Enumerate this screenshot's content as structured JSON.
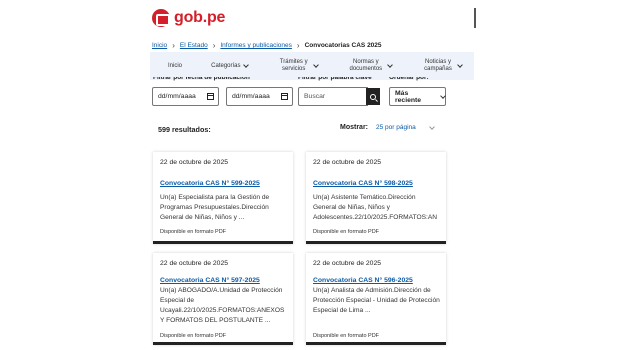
{
  "brand": {
    "name": "gob.pe"
  },
  "breadcrumb": {
    "items": [
      "Inicio",
      "El Estado",
      "Informes y publicaciones"
    ],
    "current": "Convocatorias CAS 2025"
  },
  "nav": {
    "items": [
      {
        "label": "Inicio",
        "dropdown": false
      },
      {
        "label": "Categorías",
        "dropdown": true
      },
      {
        "label": "Trámites y servicios",
        "dropdown": true
      },
      {
        "label": "Normas y documentos",
        "dropdown": true
      },
      {
        "label": "Noticias y campañas",
        "dropdown": true
      }
    ]
  },
  "filters": {
    "date_label": "Filtrar por fecha de publicación",
    "keyword_label": "Filtrar por palabra clave",
    "sort_label": "Ordenar por:",
    "date_from": "dd/mm/aaaa",
    "date_to": "dd/mm/aaaa",
    "search_placeholder": "Buscar",
    "sort_value": "Más reciente"
  },
  "results": {
    "count_text": "599 resultados:",
    "show_label": "Mostrar:",
    "per_page": "25 por página"
  },
  "cards": [
    {
      "date": "22 de octubre de 2025",
      "title": "Convocatoria CAS N° 599-2025",
      "description": "Un(a) Especialista para la Gestión de Programas Presupuestales.Dirección General de Niñas, Niños y ...",
      "format": "Disponible en formato PDF"
    },
    {
      "date": "22 de octubre de 2025",
      "title": "Convocatoria CAS N° 598-2025",
      "description": "Un(a) Asistente Temático.Dirección General de Niñas, Niños y Adolescentes.22/10/2025.FORMATOS:ANEXOS Y FORMATOS DEL ...",
      "format": "Disponible en formato PDF"
    },
    {
      "date": "22 de octubre de 2025",
      "title": "Convocatoria CAS N° 597-2025",
      "description": "Un(a) ABOGADO/A.Unidad de Protección Especial de Ucayali.22/10/2025.FORMATOS:ANEXOS Y FORMATOS DEL POSTULANTE ...",
      "format": "Disponible en formato PDF"
    },
    {
      "date": "22 de octubre de 2025",
      "title": "Convocatoria CAS N° 596-2025",
      "description": "Un(a) Analista de Admisión.Dirección de Protección Especial - Unidad de Protección Especial de Lima ...",
      "format": "Disponible en formato PDF"
    }
  ]
}
